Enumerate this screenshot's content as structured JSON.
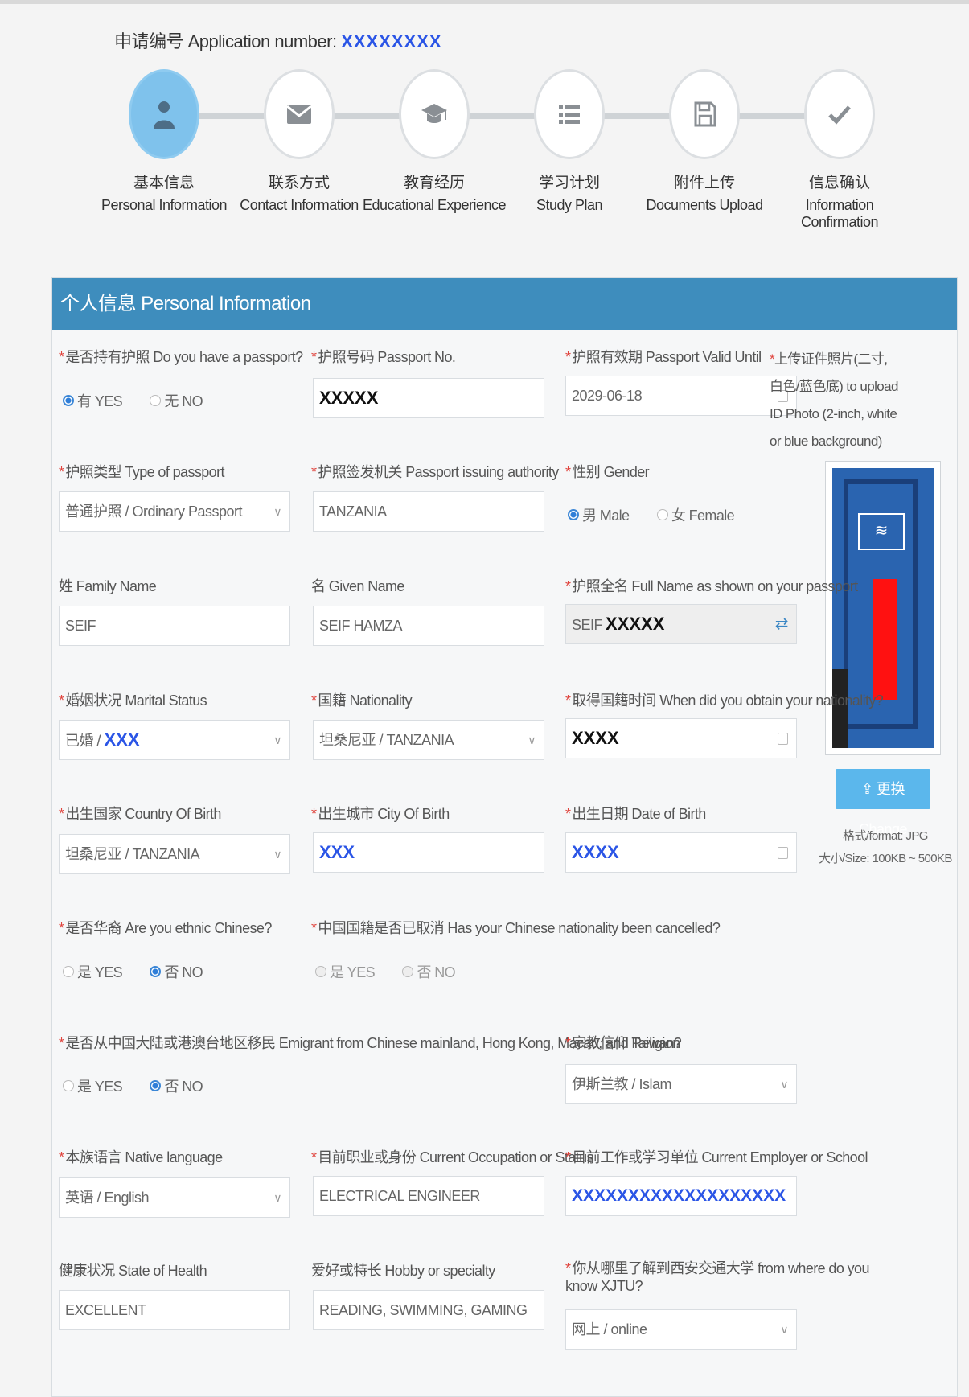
{
  "application": {
    "label": "申请编号 Application number:",
    "value": "XXXXXXXX"
  },
  "steps": [
    {
      "cn": "基本信息",
      "en": "Personal Information",
      "icon": "person-icon",
      "active": true
    },
    {
      "cn": "联系方式",
      "en": "Contact Information",
      "icon": "envelope-icon"
    },
    {
      "cn": "教育经历",
      "en": "Educational Experience",
      "icon": "graduation-cap-icon"
    },
    {
      "cn": "学习计划",
      "en": "Study Plan",
      "icon": "list-icon"
    },
    {
      "cn": "附件上传",
      "en": "Documents Upload",
      "icon": "floppy-disk-icon"
    },
    {
      "cn": "信息确认",
      "en": "Information Confirmation",
      "icon": "checkmark-icon"
    }
  ],
  "panel": {
    "title": "个人信息 Personal Information"
  },
  "fields": {
    "has_passport": {
      "label": "是否持有护照 Do you have a passport?",
      "options": [
        "有 YES",
        "无 NO"
      ],
      "selected": 0
    },
    "passport_no": {
      "label": "护照号码 Passport No.",
      "value": "XXXXX"
    },
    "passport_valid": {
      "label": "护照有效期 Passport Valid Until",
      "value": "2029-06-18"
    },
    "passport_type": {
      "label": "护照类型 Type of passport",
      "value": "普通护照 / Ordinary Passport"
    },
    "issuing_authority": {
      "label": "护照签发机关 Passport issuing authority",
      "value": "TANZANIA"
    },
    "gender": {
      "label": "性别 Gender",
      "options": [
        "男 Male",
        "女 Female"
      ],
      "selected": 0
    },
    "family_name": {
      "label": "姓 Family Name",
      "value": "SEIF"
    },
    "given_name": {
      "label": "名 Given Name",
      "value": "SEIF HAMZA"
    },
    "full_name": {
      "label": "护照全名 Full Name as shown on your passport",
      "value_prefix": "SEIF",
      "value": "XXXXX"
    },
    "marital": {
      "label": "婚姻状况 Marital Status",
      "value_prefix": "已婚 / ",
      "value": "XXX"
    },
    "nationality": {
      "label": "国籍 Nationality",
      "value": "坦桑尼亚 / TANZANIA"
    },
    "nationality_date": {
      "label": "取得国籍时间 When did you obtain your nationality?",
      "value": "XXXX"
    },
    "birth_country": {
      "label": "出生国家 Country Of Birth",
      "value": "坦桑尼亚 / TANZANIA"
    },
    "birth_city": {
      "label": "出生城市 City Of Birth",
      "value": "XXX"
    },
    "birth_date": {
      "label": "出生日期 Date of Birth",
      "value": "XXXX"
    },
    "ethnic_chinese": {
      "label": "是否华裔 Are you ethnic Chinese?",
      "options": [
        "是 YES",
        "否 NO"
      ],
      "selected": 1
    },
    "chinese_cancelled": {
      "label": "中国国籍是否已取消 Has your Chinese nationality been cancelled?",
      "options": [
        "是 YES",
        "否 NO"
      ],
      "selected": -1
    },
    "emigrant": {
      "label": "是否从中国大陆或港澳台地区移民 Emigrant from Chinese mainland, Hong Kong, Macau, and Taiwan?",
      "options": [
        "是 YES",
        "否 NO"
      ],
      "selected": 1
    },
    "religion": {
      "label": "宗教信仰 Religion",
      "value": "伊斯兰教 / Islam"
    },
    "native_language": {
      "label": "本族语言 Native language",
      "value": "英语 / English"
    },
    "occupation": {
      "label": "目前职业或身份 Current Occupation or Status",
      "value": "ELECTRICAL ENGINEER"
    },
    "employer": {
      "label": "目前工作或学习单位 Current Employer or School",
      "value": "XXXXXXXXXXXXXXXXXXX"
    },
    "health": {
      "label": "健康状况 State of Health",
      "value": "EXCELLENT"
    },
    "hobby": {
      "label": "爱好或特长 Hobby or specialty",
      "value": "READING, SWIMMING, GAMING"
    },
    "know_xjtu": {
      "label_1": "你从哪里了解到西安交通大学 from where do you",
      "label_2": "know XJTU?",
      "value": "网上 / online"
    }
  },
  "photo": {
    "label": "上传证件照片(二寸,白色/蓝色底) to upload ID Photo (2-inch, white or blue background)",
    "change": "更换 Change",
    "format": "格式/format: JPG",
    "size": "大小/Size: 100KB ~ 500KB"
  }
}
